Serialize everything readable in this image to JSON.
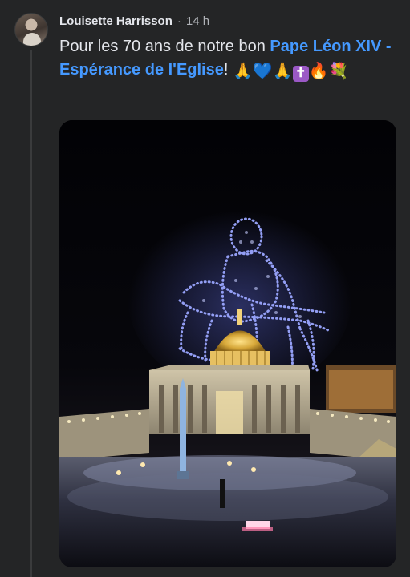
{
  "post": {
    "author": "Louisette Harrisson",
    "separator": "·",
    "time": "14 h",
    "text_prefix": "Pour les 70 ans de notre bon ",
    "link_text": "Pape Léon XIV - Espérance de l'Eglise",
    "text_suffix": "!",
    "emojis": [
      "🙏",
      "💙",
      "🙏",
      "✝",
      "🔥",
      "💐"
    ],
    "image_alt": "Drone light show depicting a Pietà sculpture above St. Peter's Basilica at night, with a crowd in the square"
  },
  "colors": {
    "background": "#242526",
    "name_text": "#e4e6eb",
    "secondary_text": "#b0b3b8",
    "link": "#4599ff"
  },
  "icons": {
    "avatar": "profile-photo"
  }
}
